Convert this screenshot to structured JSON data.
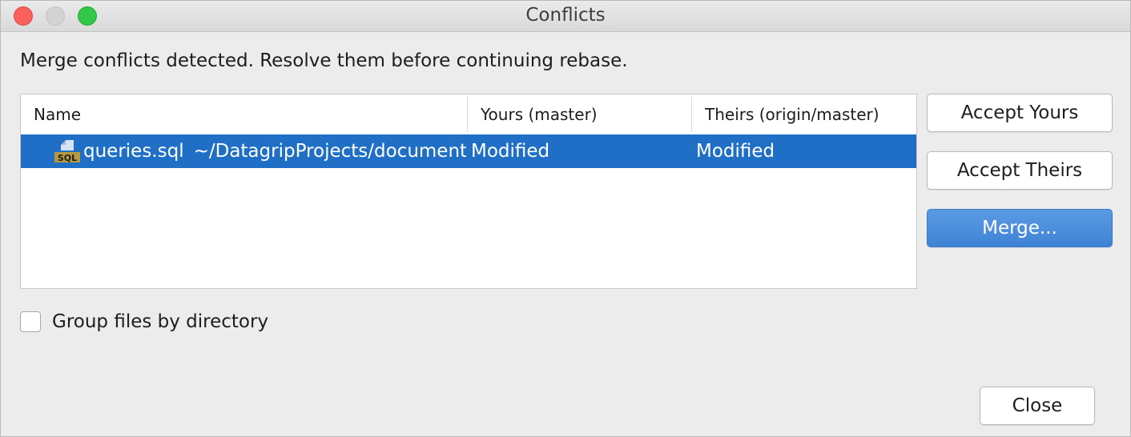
{
  "window": {
    "title": "Conflicts"
  },
  "message": "Merge conflicts detected. Resolve them before continuing rebase.",
  "table": {
    "columns": [
      "Name",
      "Yours (master)",
      "Theirs (origin/master)"
    ],
    "rows": [
      {
        "file": "queries.sql",
        "path": "~/DatagripProjects/documents",
        "yours": "Modified",
        "theirs": "Modified",
        "icon": "sql-file-icon",
        "selected": true
      }
    ]
  },
  "actions": {
    "accept_yours": "Accept Yours",
    "accept_theirs": "Accept Theirs",
    "merge": "Merge..."
  },
  "options": {
    "group_by_directory": "Group files by directory",
    "group_by_directory_checked": false
  },
  "footer": {
    "close": "Close"
  },
  "colors": {
    "selection": "#1f6fc6",
    "primary_button": "#4a8fdd",
    "icon_badge": "#b89a3e"
  }
}
